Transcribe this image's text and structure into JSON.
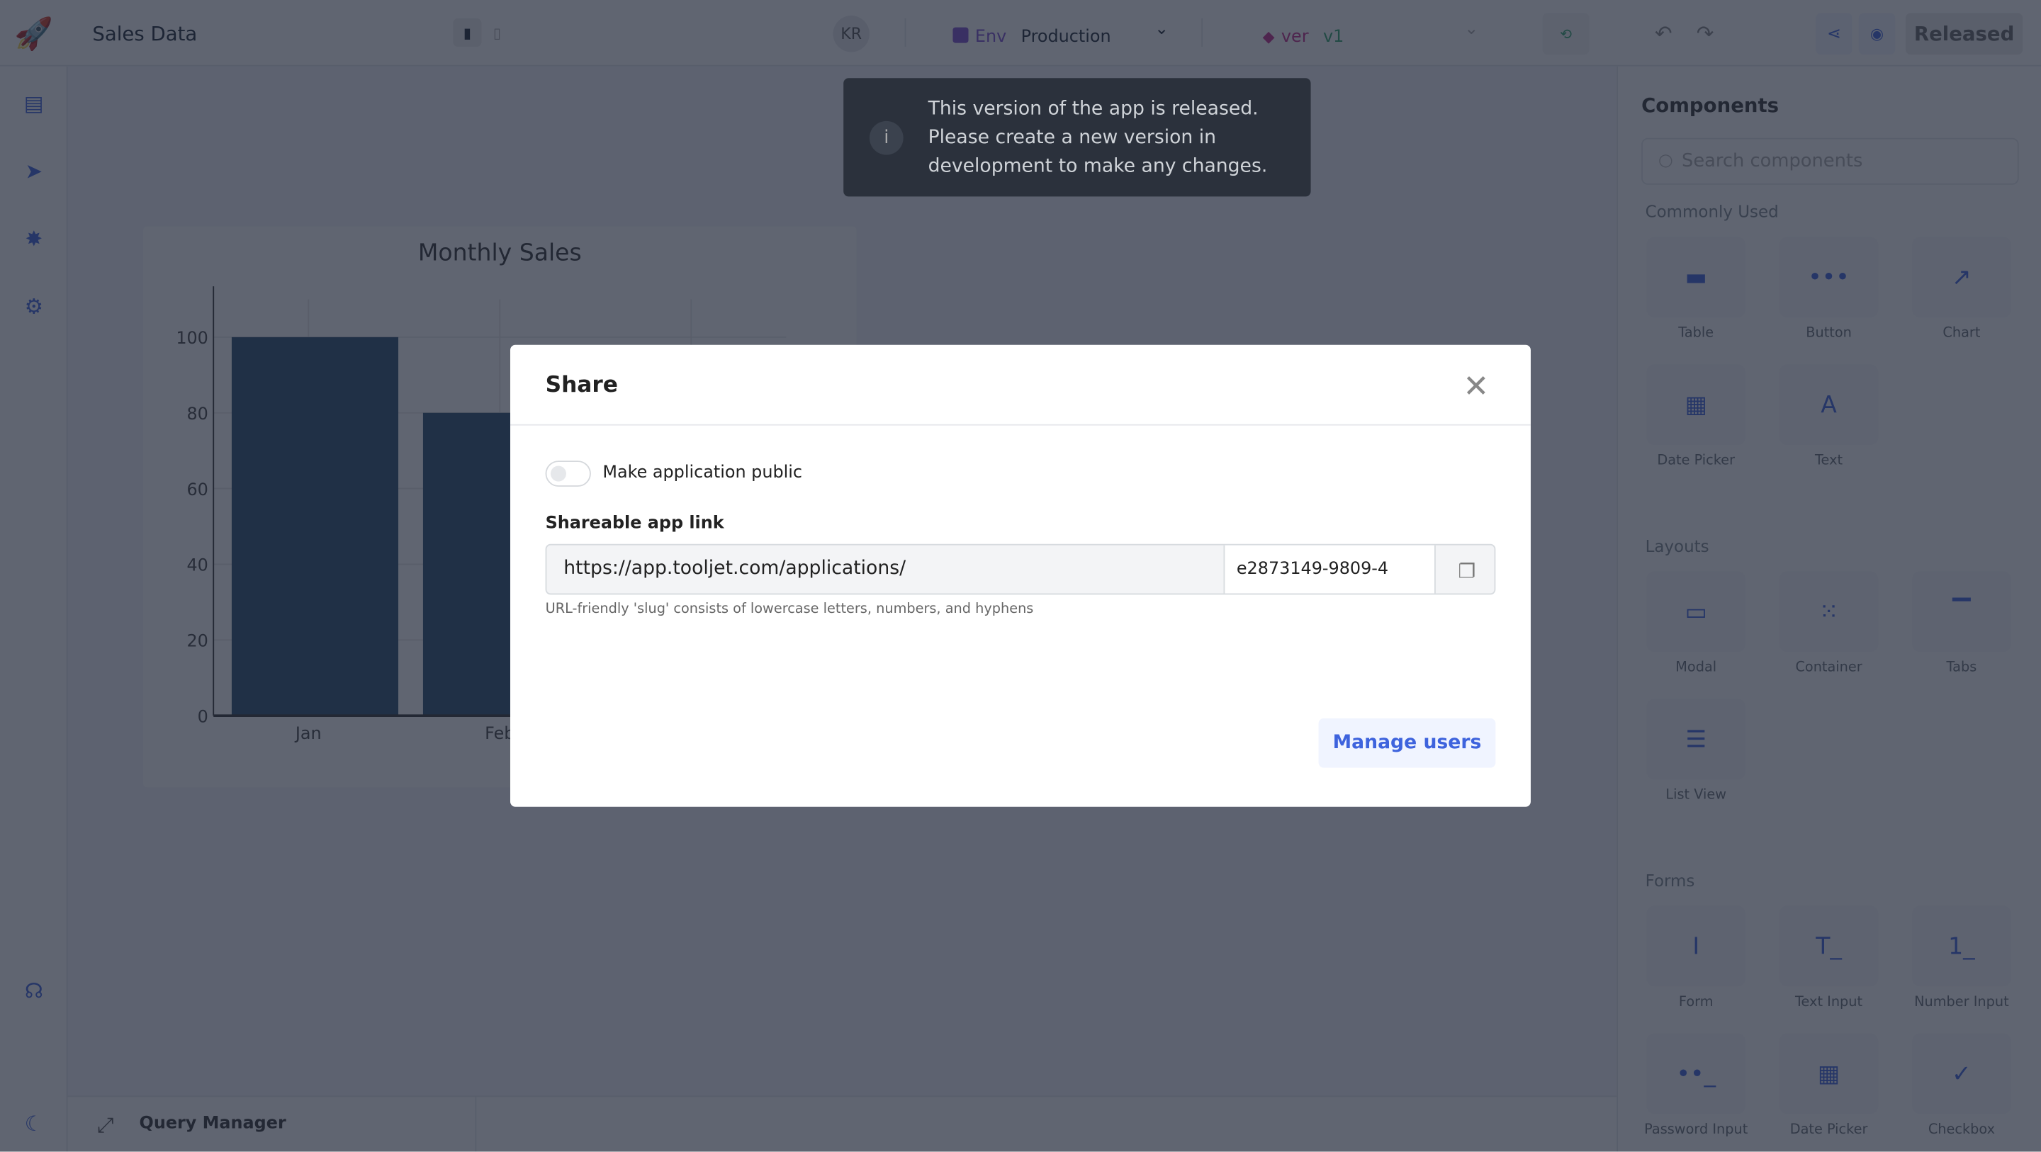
{
  "topbar": {
    "app_name": "Sales Data",
    "avatar_initials": "KR",
    "env_label": "Env",
    "env_value": "Production",
    "version_label": "ver",
    "version_value": "v1",
    "released_label": "Released"
  },
  "sidebar": {
    "icons": [
      "pages-icon",
      "inspector-icon",
      "debugger-icon",
      "settings-icon",
      "support-icon",
      "theme-toggle-icon"
    ]
  },
  "chart": {
    "title": "Monthly Sales",
    "bar_color": "#2a4f70"
  },
  "chart_data": {
    "type": "bar",
    "title": "Monthly Sales",
    "categories": [
      "Jan",
      "Feb"
    ],
    "values": [
      100,
      80
    ],
    "yticks": [
      "0",
      "20",
      "40",
      "60",
      "80",
      "100"
    ],
    "ylim": [
      0,
      110
    ],
    "grid": true
  },
  "toast": {
    "message": "This version of the app is released. Please create a new version in development to make any changes."
  },
  "right_panel": {
    "title": "Components",
    "search_placeholder": "Search components",
    "sections": [
      {
        "title": "Commonly Used",
        "items": [
          "Table",
          "Button",
          "Chart",
          "Date Picker",
          "Text"
        ]
      },
      {
        "title": "Layouts",
        "items": [
          "Modal",
          "Container",
          "Tabs",
          "List View"
        ]
      },
      {
        "title": "Forms",
        "items": [
          "Form",
          "Text Input",
          "Number Input",
          "Password Input",
          "Date Picker",
          "Checkbox"
        ]
      }
    ]
  },
  "query_manager": {
    "label": "Query Manager"
  },
  "modal": {
    "title": "Share",
    "toggle_label": "Make application public",
    "toggle_on": false,
    "link_label": "Shareable app link",
    "link_prefix": "https://app.tooljet.com/applications/",
    "slug_value": "e2873149-9809-4",
    "hint": "URL-friendly 'slug' consists of lowercase letters, numbers, and hyphens",
    "manage_users_label": "Manage users"
  },
  "colors": {
    "accent": "#3e63dd",
    "overlay": "#1c2434",
    "toast_bg": "#2b313c"
  }
}
